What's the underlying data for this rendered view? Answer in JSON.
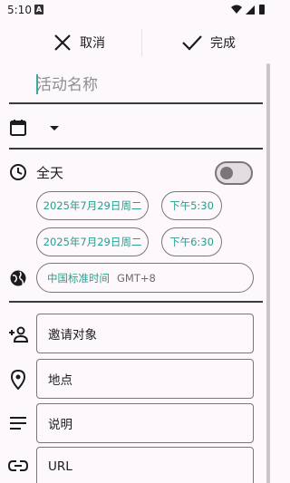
{
  "status_bar": {
    "time": "5:10",
    "notif_icon": "A"
  },
  "toolbar": {
    "cancel_label": "取消",
    "done_label": "完成"
  },
  "title_field": {
    "placeholder": "活动名称"
  },
  "calendar_row": {
    "icon": "calendar-icon",
    "dropdown_icon": "dropdown-arrow-icon"
  },
  "all_day": {
    "label": "全天",
    "toggle_on": false
  },
  "start": {
    "date": "2025年7月29日周二",
    "time": "下午5:30"
  },
  "end": {
    "date": "2025年7月29日周二",
    "time": "下午6:30"
  },
  "timezone": {
    "name": "中国标准时间",
    "offset": "GMT+8"
  },
  "fields": {
    "invite": "邀请对象",
    "location": "地点",
    "description": "说明",
    "url": "URL"
  },
  "colors": {
    "accent": "#2a9d8f",
    "divider": "#3a3a3a",
    "outline": "#7a757a"
  }
}
